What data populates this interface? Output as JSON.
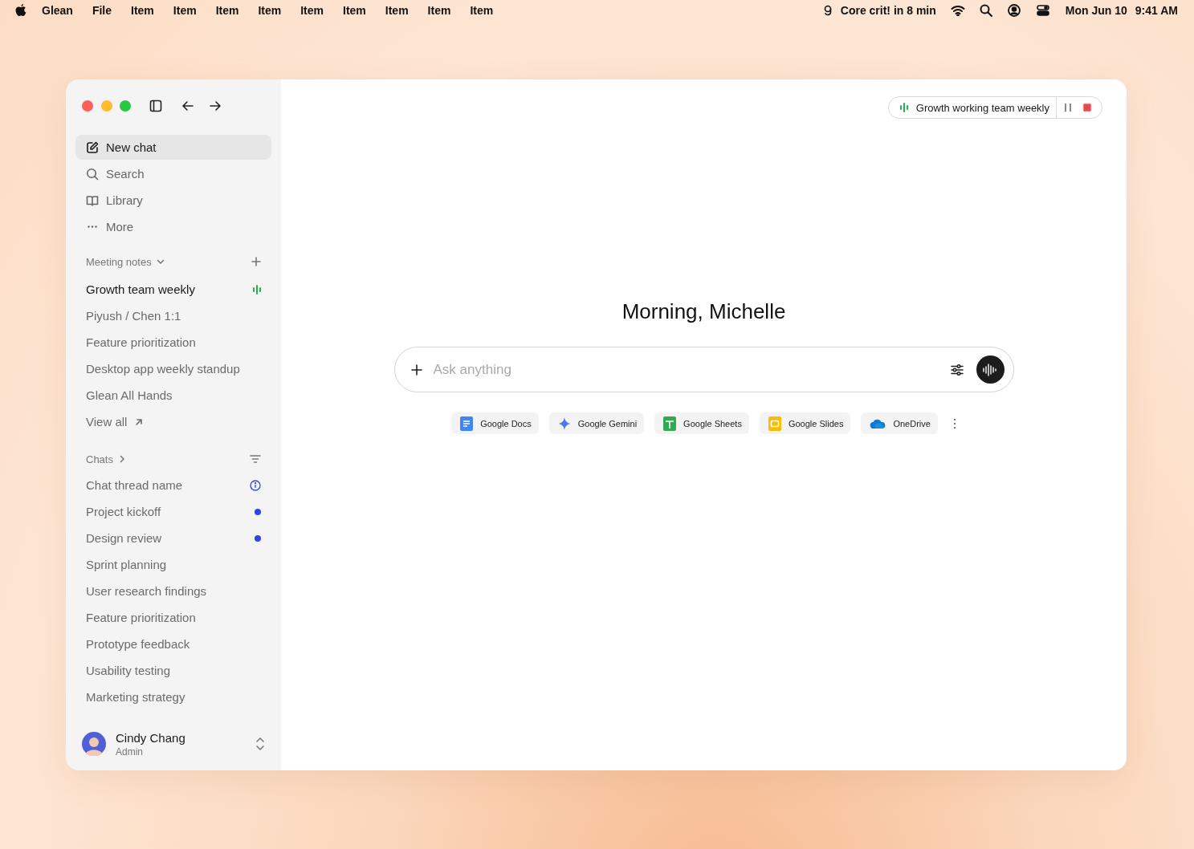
{
  "menubar": {
    "app_name": "Glean",
    "menus": [
      "File",
      "Item",
      "Item",
      "Item",
      "Item",
      "Item",
      "Item",
      "Item",
      "Item",
      "Item"
    ],
    "status_text": "Core crit! in 8 min",
    "date": "Mon Jun 10",
    "time": "9:41 AM"
  },
  "sidebar": {
    "nav": [
      {
        "kind": "new-chat",
        "label": "New chat",
        "selected": true
      },
      {
        "kind": "search",
        "label": "Search",
        "selected": false
      },
      {
        "kind": "library",
        "label": "Library",
        "selected": false
      },
      {
        "kind": "more",
        "label": "More",
        "selected": false
      }
    ],
    "meeting_notes": {
      "title": "Meeting notes",
      "items": [
        {
          "label": "Growth team weekly",
          "recording": true
        },
        {
          "label": "Piyush / Chen 1:1",
          "recording": false
        },
        {
          "label": "Feature prioritization",
          "recording": false
        },
        {
          "label": "Desktop app weekly standup",
          "recording": false
        },
        {
          "label": "Glean All Hands",
          "recording": false
        }
      ],
      "view_all": "View all"
    },
    "chats": {
      "title": "Chats",
      "items": [
        {
          "label": "Chat thread name",
          "kind": "info"
        },
        {
          "label": "Project kickoff",
          "kind": "unread"
        },
        {
          "label": "Design review",
          "kind": "unread"
        },
        {
          "label": "Sprint planning",
          "kind": "plain"
        },
        {
          "label": "User research findings",
          "kind": "plain"
        },
        {
          "label": "Feature prioritization",
          "kind": "plain"
        },
        {
          "label": "Prototype feedback",
          "kind": "plain"
        },
        {
          "label": "Usability testing",
          "kind": "plain"
        },
        {
          "label": "Marketing strategy",
          "kind": "plain"
        }
      ]
    },
    "user": {
      "name": "Cindy Chang",
      "role": "Admin"
    }
  },
  "recording": {
    "title": "Growth working team weekly"
  },
  "greeting": "Morning, Michelle",
  "ask": {
    "placeholder": "Ask anything"
  },
  "sources": [
    {
      "kind": "docs",
      "label": "Google Docs"
    },
    {
      "kind": "gemini",
      "label": "Google Gemini"
    },
    {
      "kind": "sheets",
      "label": "Google Sheets"
    },
    {
      "kind": "slides",
      "label": "Google Slides"
    },
    {
      "kind": "onedrive",
      "label": "OneDrive"
    }
  ]
}
